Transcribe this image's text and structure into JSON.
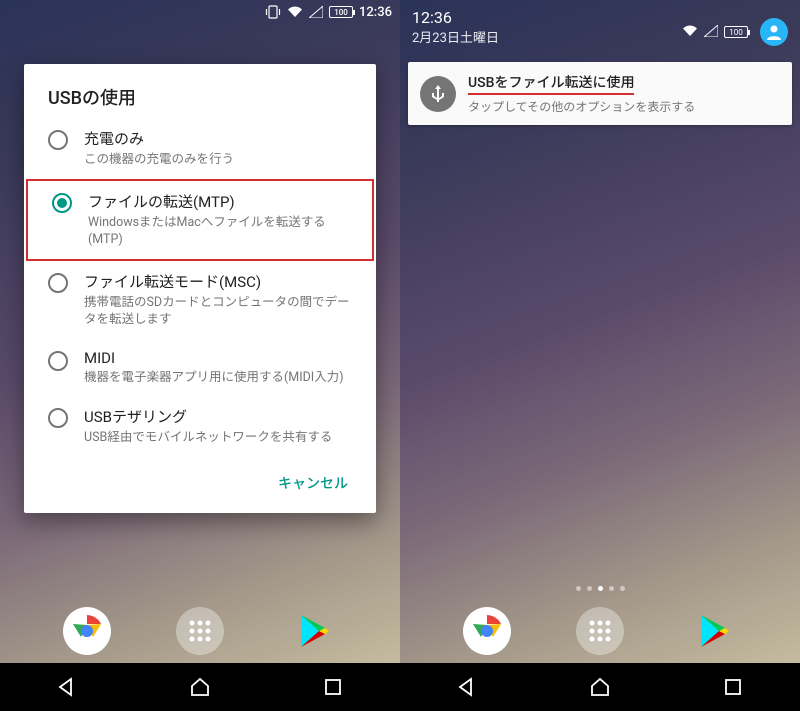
{
  "statusbar": {
    "time": "12:36",
    "battery": "100"
  },
  "dialog": {
    "title": "USBの使用",
    "options": [
      {
        "label": "充電のみ",
        "desc": "この機器の充電のみを行う",
        "selected": false
      },
      {
        "label": "ファイルの転送(MTP)",
        "desc": "WindowsまたはMacへファイルを転送する(MTP)",
        "selected": true,
        "highlight": true
      },
      {
        "label": "ファイル転送モード(MSC)",
        "desc": "携帯電話のSDカードとコンピュータの間でデータを転送します",
        "selected": false
      },
      {
        "label": "MIDI",
        "desc": "機器を電子楽器アプリ用に使用する(MIDI入力)",
        "selected": false
      },
      {
        "label": "USBテザリング",
        "desc": "USB経由でモバイルネットワークを共有する",
        "selected": false
      }
    ],
    "cancel": "キャンセル"
  },
  "notifHeader": {
    "time": "12:36",
    "date": "2月23日土曜日",
    "battery": "100"
  },
  "notification": {
    "title": "USBをファイル転送に使用",
    "sub": "タップしてその他のオプションを表示する"
  }
}
